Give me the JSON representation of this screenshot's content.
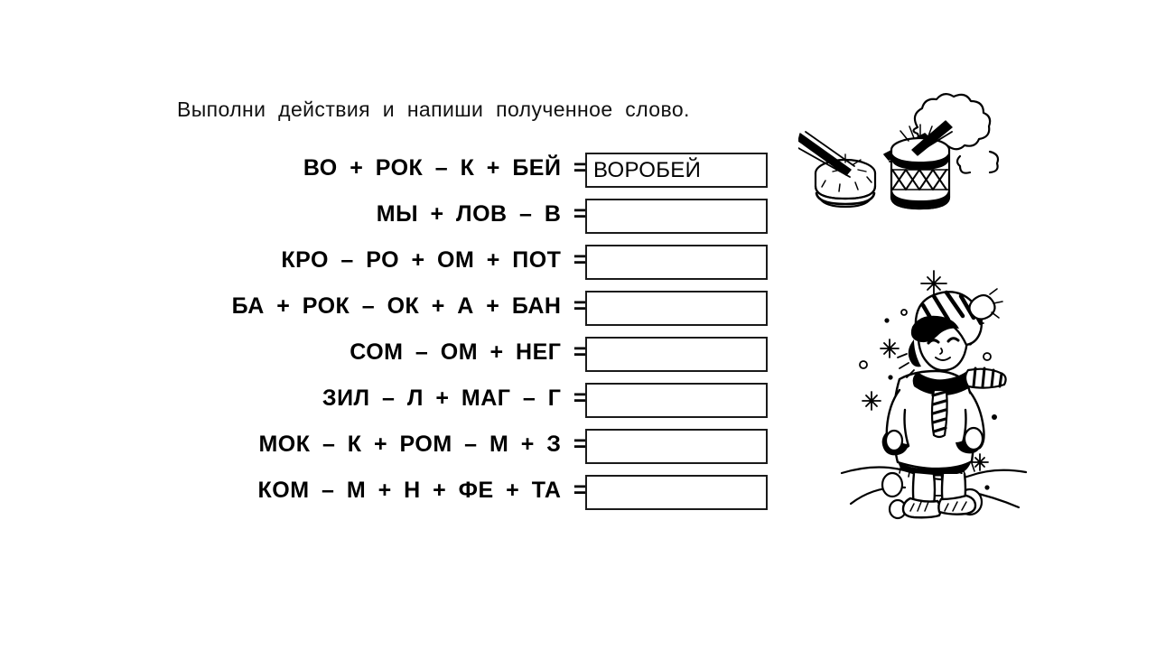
{
  "page": {
    "background_color": "#ffffff",
    "ink_color": "#000000",
    "title": "Выполни действия и напиши полученное слово."
  },
  "equations": [
    {
      "expression": "ВО + РОК – К + БЕЙ =",
      "answer": "ВОРОБЕЙ"
    },
    {
      "expression": "МЫ + ЛОВ – В =",
      "answer": ""
    },
    {
      "expression": "КРО – РО + ОМ + ПОТ =",
      "answer": ""
    },
    {
      "expression": "БА + РОК – ОК + А + БАН =",
      "answer": ""
    },
    {
      "expression": "СОМ – ОМ + НЕГ =",
      "answer": ""
    },
    {
      "expression": "ЗИЛ – Л + МАГ – Г =",
      "answer": ""
    },
    {
      "expression": "МОК – К + РОМ – М + З =",
      "answer": ""
    },
    {
      "expression": "КОМ – М + Н + ФЕ + ТА =",
      "answer": ""
    }
  ],
  "illustrations": [
    {
      "name": "drums-illustration",
      "description": "Два барабана с палочками и облачко"
    },
    {
      "name": "winter-child-illustration",
      "description": "Ребёнок в зимней одежде под снежинками"
    }
  ]
}
